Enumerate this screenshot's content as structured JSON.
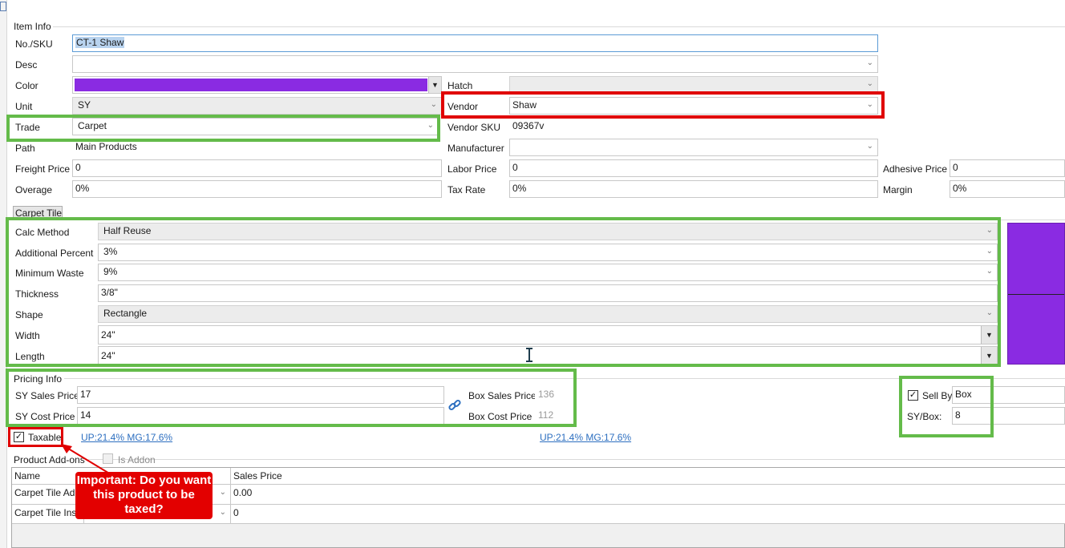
{
  "item_info": {
    "group_title": "Item Info",
    "sku_label": "No./SKU",
    "sku_value": "CT-1 Shaw",
    "desc_label": "Desc",
    "desc_value": "",
    "color_label": "Color",
    "color_swatch": "#8a2be2",
    "hatch_label": "Hatch",
    "hatch_value": "",
    "unit_label": "Unit",
    "unit_value": "SY",
    "vendor_label": "Vendor",
    "vendor_value": "Shaw",
    "trade_label": "Trade",
    "trade_value": "Carpet",
    "vendor_sku_label": "Vendor SKU",
    "vendor_sku_value": "09367v",
    "path_label": "Path",
    "path_value": "Main Products",
    "manufacturer_label": "Manufacturer",
    "manufacturer_value": "",
    "freight_label": "Freight Price",
    "freight_value": "0",
    "labor_label": "Labor Price",
    "labor_value": "0",
    "adhesive_label": "Adhesive Price",
    "adhesive_value": "0",
    "overage_label": "Overage",
    "overage_value": "0%",
    "tax_rate_label": "Tax Rate",
    "tax_rate_value": "0%",
    "margin_label": "Margin",
    "margin_value": "0%"
  },
  "carpet_tile": {
    "tab_label": "Carpet Tile",
    "calc_method_label": "Calc Method",
    "calc_method_value": "Half Reuse",
    "additional_percent_label": "Additional Percent",
    "additional_percent_value": "3%",
    "minimum_waste_label": "Minimum Waste",
    "minimum_waste_value": "9%",
    "thickness_label": "Thickness",
    "thickness_value": "3/8\"",
    "shape_label": "Shape",
    "shape_value": "Rectangle",
    "width_label": "Width",
    "width_value": "24\"",
    "length_label": "Length",
    "length_value": "24\"",
    "preview_color": "#8a2be2"
  },
  "pricing": {
    "group_title": "Pricing Info",
    "sales_price_label": "SY Sales Price",
    "sales_price_value": "17",
    "cost_price_label": "SY Cost Price",
    "cost_price_value": "14",
    "box_sales_label": "Box Sales Price",
    "box_sales_value": "136",
    "box_cost_label": "Box Cost Price",
    "box_cost_value": "112",
    "sell_by_label": "Sell By",
    "sell_by_value": "Box",
    "sy_box_label": "SY/Box:",
    "sy_box_value": "8",
    "taxable_label": "Taxable",
    "margin_link_left": "UP:21.4% MG:17.6%",
    "margin_link_right": "UP:21.4% MG:17.6%"
  },
  "addons": {
    "group_title": "Product Add-ons",
    "is_addon_label": "Is Addon",
    "col_name": "Name",
    "col_sales_price": "Sales Price",
    "rows": [
      {
        "name": "Carpet Tile Adh",
        "sales_price": "0.00"
      },
      {
        "name": "Carpet Tile Inst",
        "sales_price": "0"
      }
    ]
  },
  "callout": {
    "text": "Important: Do you want this product to be taxed?",
    "color": "#e30000"
  },
  "annotation_colors": {
    "green": "#64bb4a",
    "red": "#e00000"
  }
}
